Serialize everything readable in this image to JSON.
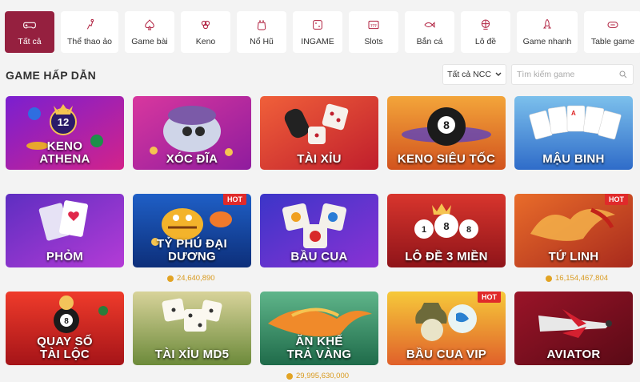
{
  "categories": [
    {
      "label": "Tất cả",
      "icon": "gamepad-icon",
      "active": true
    },
    {
      "label": "Thể thao ảo",
      "icon": "kick-icon",
      "active": false
    },
    {
      "label": "Game bài",
      "icon": "spade-icon",
      "active": false
    },
    {
      "label": "Keno",
      "icon": "keno-icon",
      "active": false
    },
    {
      "label": "Nổ Hũ",
      "icon": "jackpot-pot-icon",
      "active": false
    },
    {
      "label": "INGAME",
      "icon": "dice-icon",
      "active": false
    },
    {
      "label": "Slots",
      "icon": "slot-777-icon",
      "active": false
    },
    {
      "label": "Bắn cá",
      "icon": "fish-icon",
      "active": false
    },
    {
      "label": "Lô đề",
      "icon": "lottery-globe-icon",
      "active": false
    },
    {
      "label": "Game nhanh",
      "icon": "rocket-icon",
      "active": false
    },
    {
      "label": "Table game",
      "icon": "table-icon",
      "active": false
    }
  ],
  "section": {
    "title": "GAME HẤP DẪN"
  },
  "filter": {
    "provider_value": "Tất cả NCC"
  },
  "search": {
    "placeholder": "Tìm kiếm game"
  },
  "hot_label": "HOT",
  "games": [
    {
      "title_line1": "KENO",
      "title_line2": "ATHENA",
      "hot": false,
      "jackpot": ""
    },
    {
      "title_line1": "XÓC ĐĨA",
      "title_line2": "",
      "hot": false,
      "jackpot": ""
    },
    {
      "title_line1": "TÀI XỈU",
      "title_line2": "",
      "hot": false,
      "jackpot": ""
    },
    {
      "title_line1": "KENO SIÊU TỐC",
      "title_line2": "",
      "hot": false,
      "jackpot": ""
    },
    {
      "title_line1": "MẬU BINH",
      "title_line2": "",
      "hot": false,
      "jackpot": ""
    },
    {
      "title_line1": "PHỎM",
      "title_line2": "",
      "hot": false,
      "jackpot": ""
    },
    {
      "title_line1": "TỶ PHÚ ĐẠI DƯƠNG",
      "title_line2": "",
      "hot": true,
      "jackpot": "24,640,890"
    },
    {
      "title_line1": "BẦU CUA",
      "title_line2": "",
      "hot": false,
      "jackpot": ""
    },
    {
      "title_line1": "LÔ ĐỀ 3 MIỀN",
      "title_line2": "",
      "hot": false,
      "jackpot": ""
    },
    {
      "title_line1": "TỨ LINH",
      "title_line2": "",
      "hot": true,
      "jackpot": "16,154,467,804"
    },
    {
      "title_line1": "QUAY SỐ",
      "title_line2": "TÀI LỘC",
      "hot": false,
      "jackpot": ""
    },
    {
      "title_line1": "TÀI XỈU MD5",
      "title_line2": "",
      "hot": false,
      "jackpot": ""
    },
    {
      "title_line1": "ĂN KHẾ",
      "title_line2": "TRẢ VÀNG",
      "hot": false,
      "jackpot": "29,995,630,000"
    },
    {
      "title_line1": "BẦU CUA VIP",
      "title_line2": "",
      "hot": true,
      "jackpot": ""
    },
    {
      "title_line1": "AVIATOR",
      "title_line2": "",
      "hot": false,
      "jackpot": ""
    }
  ],
  "colors": {
    "accent": "#95203f",
    "jackpot": "#d99a1e",
    "hot": "#e02a2a"
  }
}
